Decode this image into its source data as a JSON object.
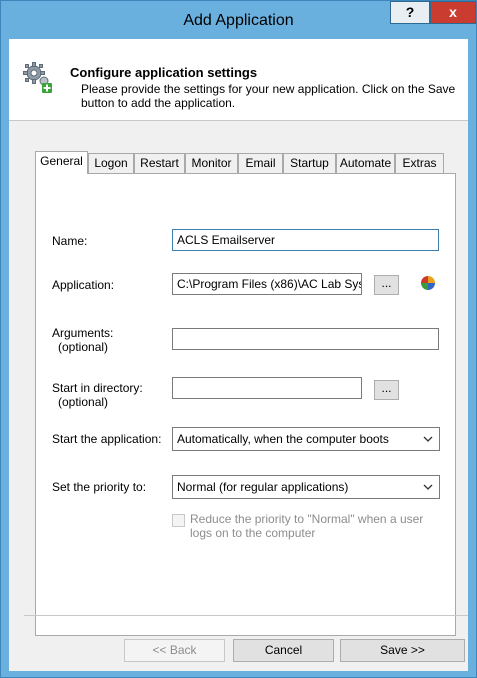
{
  "window": {
    "title": "Add Application",
    "help_label": "?",
    "close_label": "x"
  },
  "header": {
    "title": "Configure application settings",
    "description": "Please provide the settings for your new application. Click on the Save button to add the application."
  },
  "tabs": [
    {
      "label": "General",
      "active": true
    },
    {
      "label": "Logon"
    },
    {
      "label": "Restart"
    },
    {
      "label": "Monitor"
    },
    {
      "label": "Email"
    },
    {
      "label": "Startup"
    },
    {
      "label": "Automate"
    },
    {
      "label": "Extras"
    }
  ],
  "form": {
    "name": {
      "label": "Name:",
      "value": "ACLS Emailserver"
    },
    "application": {
      "label": "Application:",
      "value": "C:\\Program Files (x86)\\AC Lab Sys",
      "browse_label": "..."
    },
    "arguments": {
      "label": "Arguments:",
      "hint": "(optional)",
      "value": ""
    },
    "start_dir": {
      "label": "Start in directory:",
      "hint": "(optional)",
      "value": "",
      "browse_label": "..."
    },
    "start_app": {
      "label": "Start the application:",
      "selected": "Automatically, when the computer boots"
    },
    "priority": {
      "label": "Set the priority to:",
      "selected": "Normal (for regular applications)"
    },
    "reduce_priority": {
      "label": "Reduce the priority to \"Normal\" when a user logs on to the computer",
      "checked": false,
      "enabled": false
    }
  },
  "buttons": {
    "back": "<< Back",
    "cancel": "Cancel",
    "save": "Save >>"
  },
  "colors": {
    "titlebar": "#6ab0de",
    "close": "#c93c2f",
    "dialog_bg": "#f0f0f0"
  }
}
